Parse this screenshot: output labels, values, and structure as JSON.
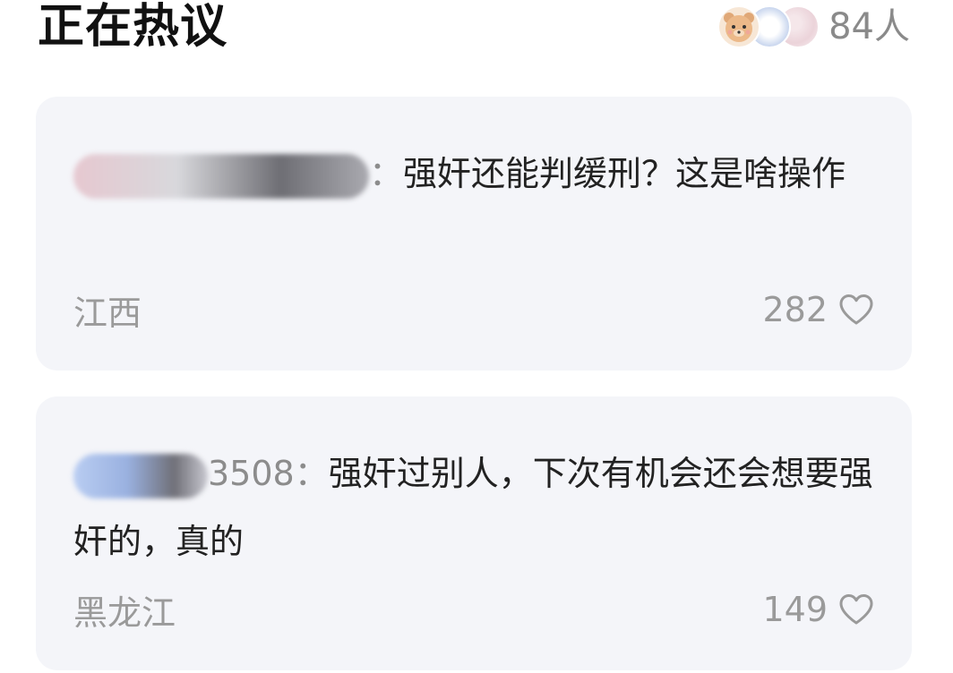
{
  "header": {
    "title": "正在热议",
    "participants": {
      "count": "84人",
      "avatars": [
        "bear-avatar",
        "blue-ring-avatar",
        "pink-avatar"
      ]
    }
  },
  "comments": [
    {
      "username_suffix": "",
      "separator": "：",
      "text": "强奸还能判缓刑？这是啥操作",
      "location": "江西",
      "likes": "282"
    },
    {
      "username_suffix": "3508",
      "separator": "：",
      "text": "强奸过别人，下次有机会还会想要强奸的，真的",
      "location": "黑龙江",
      "likes": "149"
    }
  ],
  "colors": {
    "card_bg": "#f4f5f9",
    "secondary_text": "#9a9a9a",
    "primary_text": "#222222"
  }
}
